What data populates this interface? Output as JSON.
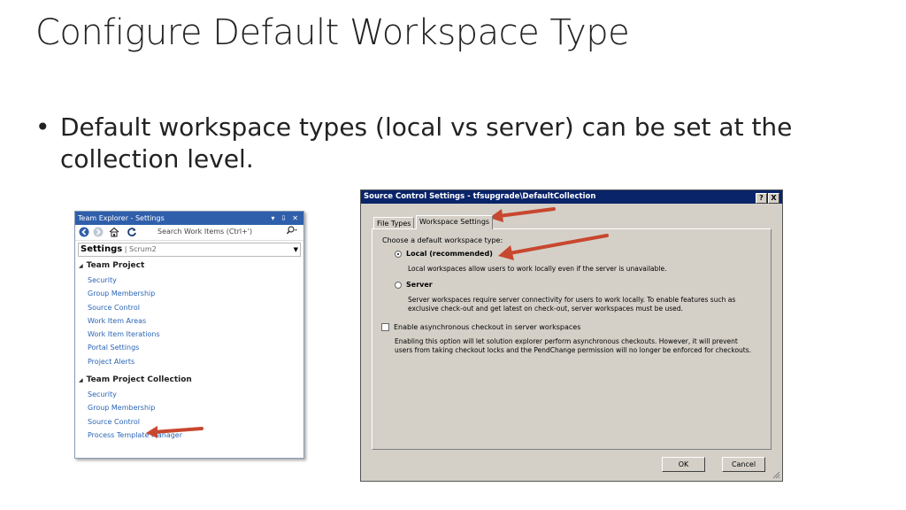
{
  "slide": {
    "title": "Configure Default Workspace Type",
    "bullet_marker": "•",
    "bullet_line1": "Default workspace types (local vs server) can be set at the",
    "bullet_line2": "collection level."
  },
  "team_explorer": {
    "title": "Team Explorer - Settings",
    "window_controls": "▾ ⇩ ✕",
    "search_placeholder": "Search Work Items (Ctrl+')",
    "settings_label": "Settings",
    "settings_separator": " | ",
    "settings_context": "Scrum2",
    "sections": [
      {
        "heading": "Team Project",
        "links": [
          "Security",
          "Group Membership",
          "Source Control",
          "Work Item Areas",
          "Work Item Iterations",
          "Portal Settings",
          "Project Alerts"
        ]
      },
      {
        "heading": "Team Project Collection",
        "links": [
          "Security",
          "Group Membership",
          "Source Control",
          "Process Template Manager"
        ]
      }
    ]
  },
  "dialog": {
    "title": "Source Control Settings - tfsupgrade\\DefaultCollection",
    "help_btn": "?",
    "close_btn": "X",
    "tabs": [
      "File Types",
      "Workspace Settings"
    ],
    "active_tab": "Workspace Settings",
    "prompt": "Choose a default workspace type:",
    "local_label": "Local (recommended)",
    "local_selected": true,
    "local_desc": "Local workspaces allow users to work locally even if the server is unavailable.",
    "server_label": "Server",
    "server_desc_line1": "Server workspaces require server connectivity for users to work locally. To enable features such as",
    "server_desc_line2": "exclusive check-out and get latest on check-out, server workspaces must be used.",
    "async_label": "Enable asynchronous checkout in server workspaces",
    "async_checked": false,
    "async_desc_line1": "Enabling this option will let solution explorer perform asynchronous checkouts. However, it will prevent",
    "async_desc_line2": "users from taking checkout locks and the PendChange permission will no longer be enforced for checkouts.",
    "ok_label": "OK",
    "cancel_label": "Cancel"
  },
  "colors": {
    "annotation_arrow": "#c8472f",
    "link": "#2b65b6",
    "dialog_titlebar": "#0a246a",
    "explorer_titlebar": "#2f5fab"
  }
}
